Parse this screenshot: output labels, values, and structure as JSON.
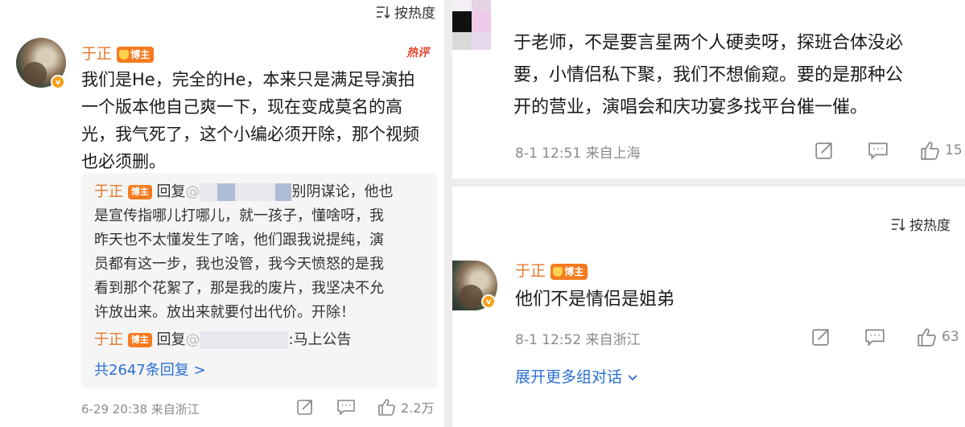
{
  "left": {
    "sort_label": "按热度",
    "comment": {
      "username": "于正",
      "badge": "博主",
      "hot_tag": "热评",
      "text_lines": [
        "我们是He，完全的He，本来只是满足导演拍",
        "一个版本他自己爽一下，现在变成莫名的高",
        "光，我气死了，这个小编必须开除，那个视频",
        "也必须删。"
      ],
      "replies": {
        "first": {
          "username": "于正",
          "badge": "博主",
          "prefix": "回复",
          "at": "@",
          "lead": "别阴谋论，他也",
          "lines": [
            "是宣传指哪儿打哪儿，就一孩子，懂啥呀，我",
            "昨天也不太懂发生了啥，他们跟我说提纯，演",
            "员都有这一步，我也没管，我今天愤怒的是我",
            "看到那个花絮了，那是我的废片，我坚决不允",
            "许放出来。放出来就要付出代价。开除！"
          ]
        },
        "second": {
          "username": "于正",
          "badge": "博主",
          "prefix": "回复",
          "at": "@",
          "tail": ":马上公告"
        },
        "more": "共2647条回复 >"
      },
      "meta": "6-29 20:38 来自浙江",
      "likes": "2.2万"
    }
  },
  "right": {
    "top_comment": {
      "text_lines": [
        "于老师，不是要言星两个人硬卖呀，探班合体没必",
        "要，小情侣私下聚，我们不想偷窥。要的是那种公",
        "开的营业，演唱会和庆功宴多找平台催一催。"
      ],
      "meta": "8-1 12:51 来自上海",
      "likes": "15"
    },
    "sort_label": "按热度",
    "reply_comment": {
      "username": "于正",
      "badge": "博主",
      "text": "他们不是情侣是姐弟",
      "meta": "8-1 12:52 来自浙江",
      "likes": "63"
    },
    "expand_label": "展开更多组对话"
  },
  "colors": {
    "username": "#e3782c",
    "link": "#2a6fd6",
    "badge": "#f57b1f",
    "meta": "#8a8a8a"
  },
  "icons": [
    "sort-icon",
    "share-icon",
    "comment-icon",
    "like-icon",
    "chevron-down-icon",
    "verified-icon"
  ]
}
